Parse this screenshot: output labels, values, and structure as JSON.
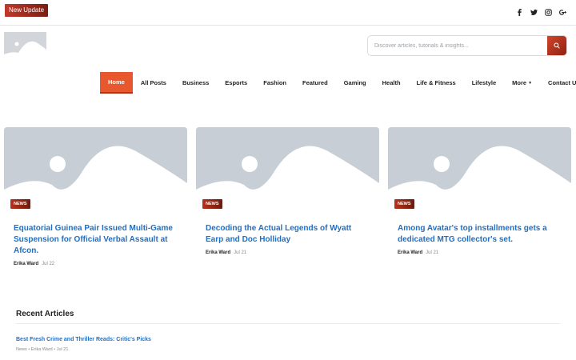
{
  "topbar": {
    "update_label": "New Update",
    "social": [
      "facebook-icon",
      "twitter-icon",
      "instagram-icon",
      "google-plus-icon"
    ]
  },
  "search": {
    "placeholder": "Discover articles, tutorials & insights..."
  },
  "nav": {
    "items": [
      {
        "label": "Home",
        "active": true
      },
      {
        "label": "All Posts"
      },
      {
        "label": "Business"
      },
      {
        "label": "Esports"
      },
      {
        "label": "Fashion"
      },
      {
        "label": "Featured"
      },
      {
        "label": "Gaming"
      },
      {
        "label": "Health"
      },
      {
        "label": "Life & Fitness"
      },
      {
        "label": "Lifestyle"
      },
      {
        "label": "More"
      },
      {
        "label": "Contact Us"
      }
    ]
  },
  "cards": [
    {
      "badge": "NEWS",
      "title": "Equatorial Guinea Pair Issued Multi-Game Suspension for Official Verbal Assault at Afcon.",
      "author": "Erika Ward",
      "date": "Jul 22"
    },
    {
      "badge": "NEWS",
      "title": "Decoding the Actual Legends of Wyatt Earp and Doc Holliday",
      "author": "Erika Ward",
      "date": "Jul 21"
    },
    {
      "badge": "NEWS",
      "title": "Among Avatar's top installments gets a dedicated MTG collector's set.",
      "author": "Erika Ward",
      "date": "Jul 21"
    }
  ],
  "recent": {
    "heading": "Recent Articles",
    "items": [
      {
        "title": "Best Fresh Crime and Thriller Reads: Critic's Picks",
        "meta": "News • Erika Ward • Jul 21"
      }
    ]
  },
  "colors": {
    "accent": "#e8582f",
    "link": "#1f6fc5",
    "placeholder_image": "#c8ced5"
  }
}
